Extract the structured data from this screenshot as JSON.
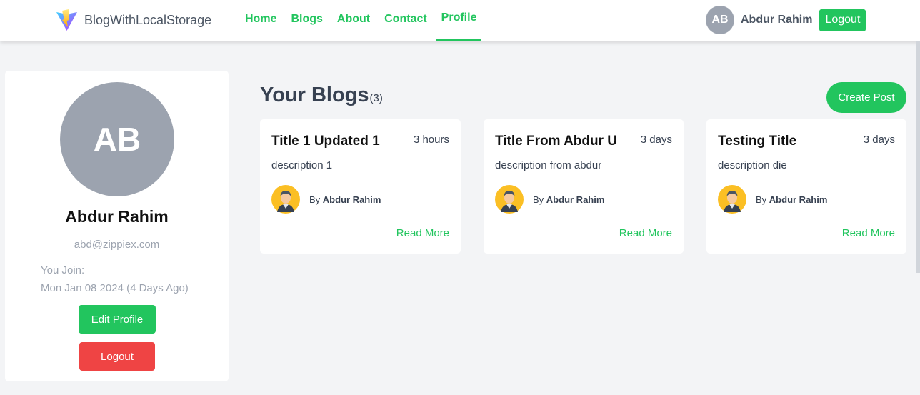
{
  "brand": {
    "name": "BlogWithLocalStorage",
    "logo": "vite-logo-icon"
  },
  "nav": {
    "links": [
      {
        "label": "Home"
      },
      {
        "label": "Blogs"
      },
      {
        "label": "About"
      },
      {
        "label": "Contact"
      },
      {
        "label": "Profile",
        "active": true
      }
    ],
    "user": {
      "initials": "AB",
      "name": "Abdur Rahim"
    },
    "logout_label": "Logout"
  },
  "profile": {
    "initials": "AB",
    "name": "Abdur Rahim",
    "email": "abd@zippiex.com",
    "join_label": "You Join:",
    "join_date": "Mon Jan 08 2024 (4 Days Ago)",
    "edit_label": "Edit Profile",
    "logout_label": "Logout"
  },
  "blogs": {
    "heading": "Your Blogs",
    "count": "(3)",
    "create_label": "Create Post",
    "posts": [
      {
        "title": "Title 1 Updated 1",
        "time": "3 hours",
        "description": "description 1",
        "by": "By",
        "author": "Abdur Rahim",
        "read_more": "Read More"
      },
      {
        "title": "Title From Abdur U",
        "time": "3 days",
        "description": "description from abdur",
        "by": "By",
        "author": "Abdur Rahim",
        "read_more": "Read More"
      },
      {
        "title": "Testing Title",
        "time": "3 days",
        "description": "description die",
        "by": "By",
        "author": "Abdur Rahim",
        "read_more": "Read More"
      }
    ]
  },
  "colors": {
    "accent": "#22c55e",
    "danger": "#ef4444",
    "avatar_gray": "#9ca3af",
    "background": "#f3f4f6"
  }
}
